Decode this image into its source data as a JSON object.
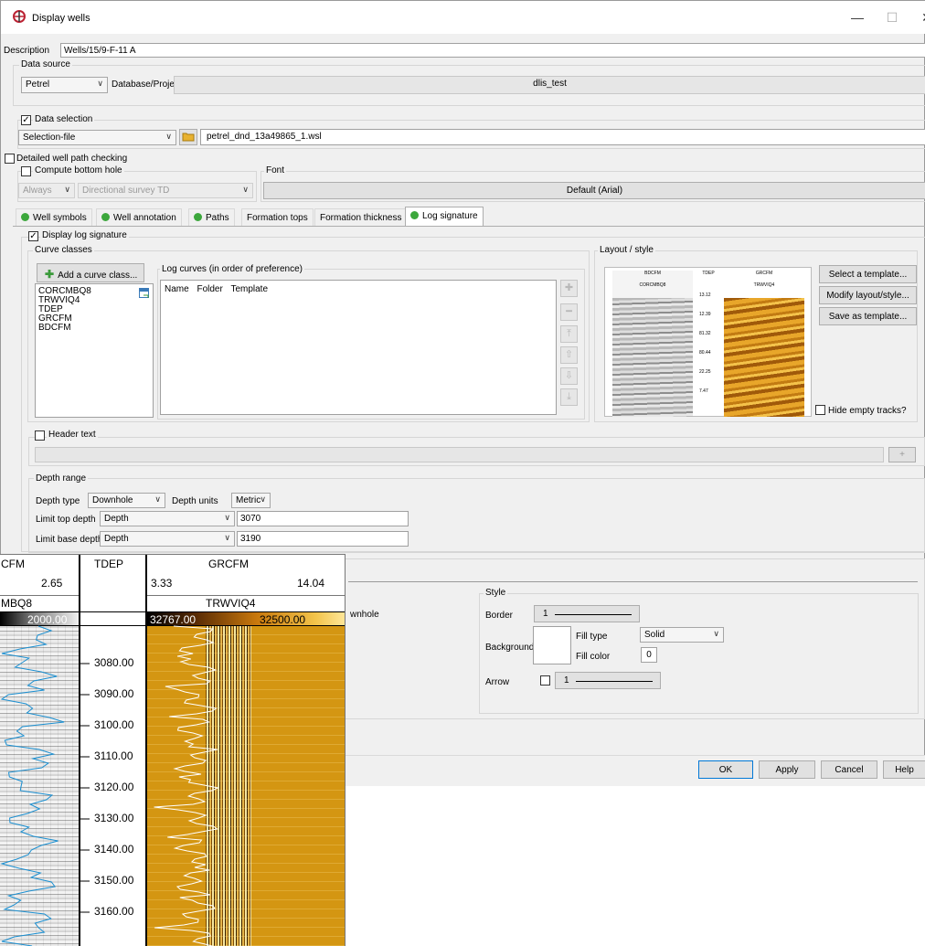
{
  "window": {
    "title": "Display wells",
    "minimize": "—",
    "maximize": "☐",
    "close": "✕"
  },
  "description": {
    "label": "Description",
    "value": "Wells/15/9-F-11 A"
  },
  "data_source": {
    "label": "Data source",
    "source_value": "Petrel",
    "db_label": "Database/Project",
    "db_value": "dlis_test"
  },
  "data_selection": {
    "label": "Data selection",
    "checked": true,
    "mode_value": "Selection-file",
    "file_value": "petrel_dnd_13a49865_1.wsl"
  },
  "detailed_checking": {
    "label": "Detailed well path checking",
    "checked": false
  },
  "bottom_hole": {
    "label": "Compute bottom hole",
    "mode_value": "Always",
    "method_value": "Directional survey TD"
  },
  "font": {
    "label": "Font",
    "value": "Default (Arial)"
  },
  "tabs": [
    {
      "label": "Well symbols",
      "dot": true
    },
    {
      "label": "Well annotation",
      "dot": true
    },
    {
      "label": "Paths",
      "dot": true
    },
    {
      "label": "Formation tops",
      "dot": false
    },
    {
      "label": "Formation thickness",
      "dot": false
    },
    {
      "label": "Log signature",
      "dot": true,
      "active": true
    }
  ],
  "log_signature": {
    "display_label": "Display log signature",
    "curve_classes_label": "Curve classes",
    "add_class_label": "Add a curve class...",
    "classes": [
      "CORCMBQ8",
      "TRWVIQ4",
      "TDEP",
      "GRCFM",
      "BDCFM"
    ],
    "log_curves_label": "Log curves (in order of preference)",
    "columns": [
      "Name",
      "Folder",
      "Template"
    ],
    "layout_label": "Layout / style",
    "select_template": "Select a template...",
    "modify_layout": "Modify layout/style...",
    "save_template": "Save as template...",
    "hide_empty": "Hide empty tracks?"
  },
  "header_text": {
    "label": "Header text",
    "add": "+"
  },
  "depth_range": {
    "label": "Depth range",
    "depth_type_label": "Depth type",
    "depth_type_value": "Downhole",
    "depth_units_label": "Depth units",
    "depth_units_value": "Metric",
    "top_label": "Limit top depth",
    "top_mode": "Depth",
    "top_value": "3070",
    "base_label": "Limit base depth",
    "base_mode": "Depth",
    "base_value": "3190"
  },
  "style_panel": {
    "partial_text": "wnhole",
    "style_label": "Style",
    "border_label": "Border",
    "border_value": "1",
    "background_label": "Background",
    "fill_type_label": "Fill type",
    "fill_type_value": "Solid",
    "fill_color_label": "Fill color",
    "fill_color_value": "0",
    "arrow_label": "Arrow",
    "arrow_value": "1"
  },
  "footer": {
    "ok": "OK",
    "apply": "Apply",
    "cancel": "Cancel",
    "help": "Help"
  },
  "preview": {
    "bdcfm": "BDCFM",
    "tdep": "TDEP",
    "grcfm": "GRCFM",
    "corcmbq8": "CORCMBQ8",
    "trwviq4": "TRWVIQ4",
    "depths": [
      "13.12",
      "12.39",
      "81.32",
      "80.44",
      "22.25",
      "7.47"
    ]
  },
  "log_view": {
    "track1_header": "CFM",
    "track1_max": "2.65",
    "track1_sub": "MBQ8",
    "track1_submax": "2000.00",
    "track2_header": "TDEP",
    "track3_header": "GRCFM",
    "gr_min": "3.33",
    "gr_max": "14.04",
    "track3_sub": "TRWVIQ4",
    "tr_min": "32767.00",
    "tr_max": "32500.00",
    "depths": [
      "3080.00",
      "3090.00",
      "3100.00",
      "3110.00",
      "3120.00",
      "3130.00",
      "3140.00",
      "3150.00",
      "3160.00"
    ],
    "colors": {
      "gr_curve": "#1a8fd1",
      "gold": "#d49612",
      "gray": "#bdbdbd"
    }
  }
}
